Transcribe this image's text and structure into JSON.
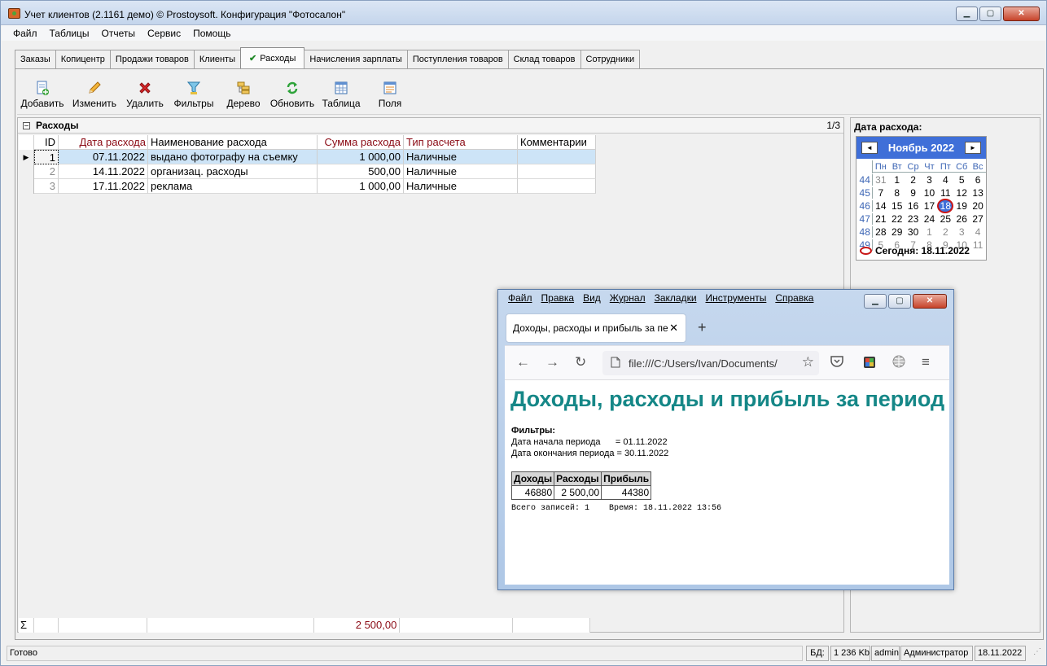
{
  "window": {
    "title": "Учет клиентов (2.1161 демо) © Prostoysoft. Конфигурация \"Фотосалон\""
  },
  "menu": [
    "Файл",
    "Таблицы",
    "Отчеты",
    "Сервис",
    "Помощь"
  ],
  "tabs": [
    "Заказы",
    "Копицентр",
    "Продажи товаров",
    "Клиенты",
    "Расходы",
    "Начисления зарплаты",
    "Поступления товаров",
    "Склад товаров",
    "Сотрудники"
  ],
  "active_tab": "Расходы",
  "toolbar": {
    "add": "Добавить",
    "edit": "Изменить",
    "delete": "Удалить",
    "filters": "Фильтры",
    "tree": "Дерево",
    "refresh": "Обновить",
    "table": "Таблица",
    "fields": "Поля"
  },
  "grid": {
    "title": "Расходы",
    "counter": "1/3",
    "columns": [
      "ID",
      "Дата расхода",
      "Наименование расхода",
      "Сумма расхода",
      "Тип расчета",
      "Комментарии"
    ],
    "rows": [
      {
        "id": "1",
        "date": "07.11.2022",
        "name": "выдано фотографу на съемку",
        "sum": "1 000,00",
        "type": "Наличные",
        "comment": ""
      },
      {
        "id": "2",
        "date": "14.11.2022",
        "name": "организац. расходы",
        "sum": "500,00",
        "type": "Наличные",
        "comment": ""
      },
      {
        "id": "3",
        "date": "17.11.2022",
        "name": "реклама",
        "sum": "1 000,00",
        "type": "Наличные",
        "comment": ""
      }
    ],
    "sigma": "Σ",
    "total": "2 500,00"
  },
  "calendar": {
    "label": "Дата расхода:",
    "month": "Ноябрь 2022",
    "prev": "◄",
    "next": "►",
    "day_names": [
      "Пн",
      "Вт",
      "Ср",
      "Чт",
      "Пт",
      "Сб",
      "Вс"
    ],
    "weeks": [
      {
        "wk": "44",
        "days": [
          "31",
          "1",
          "2",
          "3",
          "4",
          "5",
          "6"
        ]
      },
      {
        "wk": "45",
        "days": [
          "7",
          "8",
          "9",
          "10",
          "11",
          "12",
          "13"
        ]
      },
      {
        "wk": "46",
        "days": [
          "14",
          "15",
          "16",
          "17",
          "18",
          "19",
          "20"
        ]
      },
      {
        "wk": "47",
        "days": [
          "21",
          "22",
          "23",
          "24",
          "25",
          "26",
          "27"
        ]
      },
      {
        "wk": "48",
        "days": [
          "28",
          "29",
          "30",
          "1",
          "2",
          "3",
          "4"
        ]
      },
      {
        "wk": "49",
        "days": [
          "5",
          "6",
          "7",
          "8",
          "9",
          "10",
          "11"
        ]
      }
    ],
    "today": "Сегодня: 18.11.2022"
  },
  "status": {
    "ready": "Готово",
    "db_label": "БД:",
    "db_size": "1 236 Kb",
    "user": "admin",
    "role": "Администратор",
    "date": "18.11.2022"
  },
  "firefox": {
    "menu": [
      "Файл",
      "Правка",
      "Вид",
      "Журнал",
      "Закладки",
      "Инструменты",
      "Справка"
    ],
    "tab_title": "Доходы, расходы и прибыль за период",
    "url": "file:///C:/Users/Ivan/Documents/",
    "heading": "Доходы, расходы и прибыль за период",
    "filters_title": "Фильтры:",
    "filter_start": "Дата начала периода      = 01.11.2022",
    "filter_end": "Дата окончания периода = 30.11.2022",
    "report_headers": [
      "Доходы",
      "Расходы",
      "Прибыль"
    ],
    "report_values": [
      "46880",
      "2 500,00",
      "44380"
    ],
    "footer": "Всего записей: 1    Время: 18.11.2022 13:56"
  }
}
